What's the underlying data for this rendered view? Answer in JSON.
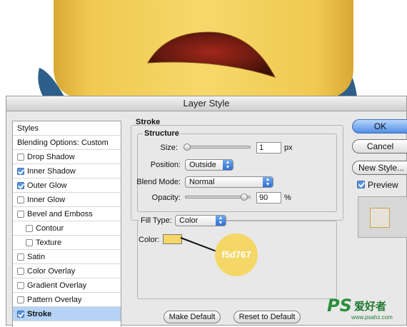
{
  "dialog": {
    "title": "Layer Style"
  },
  "styles_list": {
    "header": "Styles",
    "blending_options": "Blending Options: Custom",
    "items": [
      {
        "label": "Drop Shadow",
        "checked": false,
        "indent": false,
        "selected": false
      },
      {
        "label": "Inner Shadow",
        "checked": true,
        "indent": false,
        "selected": false
      },
      {
        "label": "Outer Glow",
        "checked": true,
        "indent": false,
        "selected": false
      },
      {
        "label": "Inner Glow",
        "checked": false,
        "indent": false,
        "selected": false
      },
      {
        "label": "Bevel and Emboss",
        "checked": false,
        "indent": false,
        "selected": false
      },
      {
        "label": "Contour",
        "checked": false,
        "indent": true,
        "selected": false
      },
      {
        "label": "Texture",
        "checked": false,
        "indent": true,
        "selected": false
      },
      {
        "label": "Satin",
        "checked": false,
        "indent": false,
        "selected": false
      },
      {
        "label": "Color Overlay",
        "checked": false,
        "indent": false,
        "selected": false
      },
      {
        "label": "Gradient Overlay",
        "checked": false,
        "indent": false,
        "selected": false
      },
      {
        "label": "Pattern Overlay",
        "checked": false,
        "indent": false,
        "selected": false
      },
      {
        "label": "Stroke",
        "checked": true,
        "indent": false,
        "selected": true
      }
    ]
  },
  "stroke": {
    "title": "Stroke",
    "structure_title": "Structure",
    "size_label": "Size:",
    "size_value": "1",
    "size_unit": "px",
    "size_slider_fraction": 0.02,
    "position_label": "Position:",
    "position_value": "Outside",
    "blend_mode_label": "Blend Mode:",
    "blend_mode_value": "Normal",
    "opacity_label": "Opacity:",
    "opacity_value": "90",
    "opacity_unit": "%",
    "opacity_slider_fraction": 0.9,
    "fill_type_label": "Fill Type:",
    "fill_type_value": "Color",
    "color_label": "Color:",
    "color_hex": "#f5d767",
    "color_callout": "f5d767"
  },
  "bottom_buttons": {
    "make_default": "Make Default",
    "reset_default": "Reset to Default"
  },
  "right_buttons": {
    "ok": "OK",
    "cancel": "Cancel",
    "new_style": "New Style...",
    "preview": "Preview",
    "preview_checked": true
  },
  "watermark": {
    "logo": "PS",
    "text": "爱好者",
    "url": "www.psahz.com"
  },
  "colors": {
    "minion_yellow": "#f3cf57",
    "mouth": "#6a1d12",
    "goggle_strap": "#2e5f8a",
    "selection": "#b5d3f5"
  }
}
